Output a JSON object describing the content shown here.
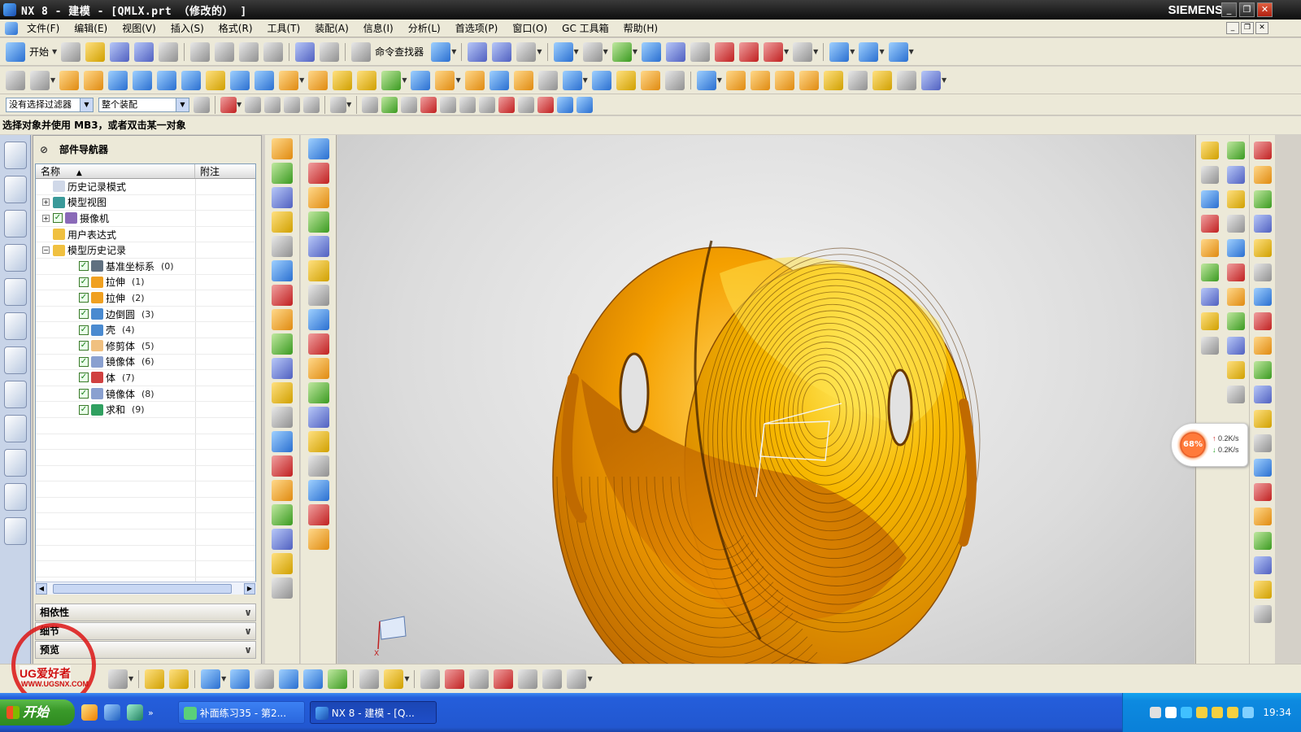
{
  "window": {
    "title": "NX 8 - 建模 - [QMLX.prt （修改的） ]",
    "brand": "SIEMENS",
    "controls": [
      "_",
      "❐",
      "✕"
    ]
  },
  "menu": {
    "items": [
      "文件(F)",
      "编辑(E)",
      "视图(V)",
      "插入(S)",
      "格式(R)",
      "工具(T)",
      "装配(A)",
      "信息(I)",
      "分析(L)",
      "首选项(P)",
      "窗口(O)",
      "GC 工具箱",
      "帮助(H)"
    ]
  },
  "toolbar": {
    "start_label": "开始",
    "command_finder_label": "命令查找器"
  },
  "filters": {
    "selection_filter": "没有选择过滤器",
    "assembly_scope": "整个装配"
  },
  "status": {
    "prompt": "选择对象并使用 MB3，或者双击某一对象"
  },
  "navigator": {
    "title": "部件导航器",
    "columns": [
      "名称",
      "附注"
    ],
    "items": [
      {
        "label": "历史记录模式",
        "index": "",
        "checked": false,
        "icon": "clock-icon"
      },
      {
        "label": "模型视图",
        "index": "",
        "checked": false,
        "icon": "model-views-icon"
      },
      {
        "label": "摄像机",
        "index": "",
        "checked": true,
        "icon": "camera-icon"
      },
      {
        "label": "用户表达式",
        "index": "",
        "checked": false,
        "icon": "folder-icon"
      },
      {
        "label": "模型历史记录",
        "index": "",
        "checked": false,
        "icon": "folder-open-icon"
      },
      {
        "label": "基准坐标系",
        "index": "(0)",
        "checked": true,
        "icon": "datum-csys-icon"
      },
      {
        "label": "拉伸",
        "index": "(1)",
        "checked": true,
        "icon": "extrude-icon"
      },
      {
        "label": "拉伸",
        "index": "(2)",
        "checked": true,
        "icon": "extrude-icon"
      },
      {
        "label": "边倒圆",
        "index": "(3)",
        "checked": true,
        "icon": "edge-blend-icon"
      },
      {
        "label": "壳",
        "index": "(4)",
        "checked": true,
        "icon": "shell-icon"
      },
      {
        "label": "修剪体",
        "index": "(5)",
        "checked": true,
        "icon": "trim-body-icon"
      },
      {
        "label": "镜像体",
        "index": "(6)",
        "checked": true,
        "icon": "mirror-body-icon"
      },
      {
        "label": "体",
        "index": "(7)",
        "checked": true,
        "icon": "body-icon"
      },
      {
        "label": "镜像体",
        "index": "(8)",
        "checked": true,
        "icon": "mirror-body-icon"
      },
      {
        "label": "求和",
        "index": "(9)",
        "checked": true,
        "icon": "unite-icon"
      }
    ],
    "sections": [
      "相依性",
      "细节",
      "预览"
    ]
  },
  "netmon": {
    "percent": "68%",
    "up": "0.2K/s",
    "down": "0.2K/s"
  },
  "taskbar": {
    "start": "开始",
    "tasks": [
      "补面练习35 - 第2...",
      "NX 8 - 建模 - [Q..."
    ],
    "clock": "19:34"
  },
  "watermark": {
    "line1": "UG爱好者",
    "line2": "WWW.UGSNX.COM"
  },
  "colors": {
    "model": "#f5a000",
    "model_dark": "#c06a00",
    "viewport_bg": "#dcdcdc",
    "taskbar": "#245edb"
  }
}
